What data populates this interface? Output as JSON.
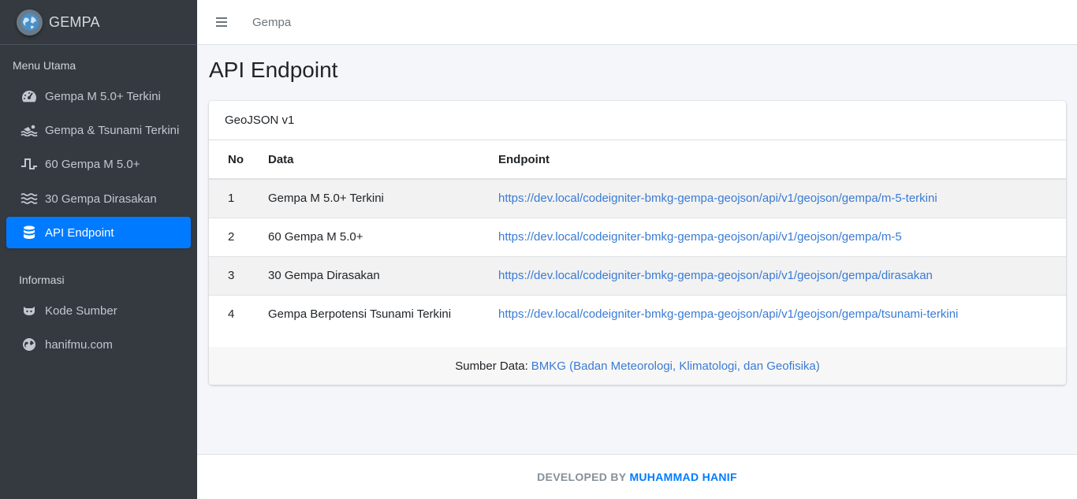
{
  "brand": {
    "name": "GEMPA"
  },
  "sidebar": {
    "header_main": "Menu Utama",
    "items": [
      {
        "label": "Gempa M 5.0+ Terkini",
        "icon": "tachometer-icon"
      },
      {
        "label": "Gempa & Tsunami Terkini",
        "icon": "swimmer-icon"
      },
      {
        "label": "60 Gempa M 5.0+",
        "icon": "wave-square-icon"
      },
      {
        "label": "30 Gempa Dirasakan",
        "icon": "water-icon"
      },
      {
        "label": "API Endpoint",
        "icon": "database-icon",
        "active": true
      }
    ],
    "header_info": "Informasi",
    "info_items": [
      {
        "label": "Kode Sumber",
        "icon": "github-icon"
      },
      {
        "label": "hanifmu.com",
        "icon": "globe-icon"
      }
    ]
  },
  "topnav": {
    "link": "Gempa"
  },
  "main": {
    "title": "API Endpoint",
    "card_title": "GeoJSON v1",
    "columns": [
      "No",
      "Data",
      "Endpoint"
    ],
    "rows": [
      {
        "no": "1",
        "data": "Gempa M 5.0+ Terkini",
        "endpoint": "https://dev.local/codeigniter-bmkg-gempa-geojson/api/v1/geojson/gempa/m-5-terkini"
      },
      {
        "no": "2",
        "data": "60 Gempa M 5.0+",
        "endpoint": "https://dev.local/codeigniter-bmkg-gempa-geojson/api/v1/geojson/gempa/m-5"
      },
      {
        "no": "3",
        "data": "30 Gempa Dirasakan",
        "endpoint": "https://dev.local/codeigniter-bmkg-gempa-geojson/api/v1/geojson/gempa/dirasakan"
      },
      {
        "no": "4",
        "data": "Gempa Berpotensi Tsunami Terkini",
        "endpoint": "https://dev.local/codeigniter-bmkg-gempa-geojson/api/v1/geojson/gempa/tsunami-terkini"
      }
    ],
    "source_label": "Sumber Data:",
    "source_link": "BMKG (Badan Meteorologi, Klimatologi, dan Geofisika)"
  },
  "footer": {
    "prefix": "DEVELOPED BY",
    "author": "MUHAMMAD HANIF"
  },
  "colors": {
    "sidebar_bg": "#343a40",
    "accent": "#007bff",
    "link": "#3a7bd5"
  }
}
